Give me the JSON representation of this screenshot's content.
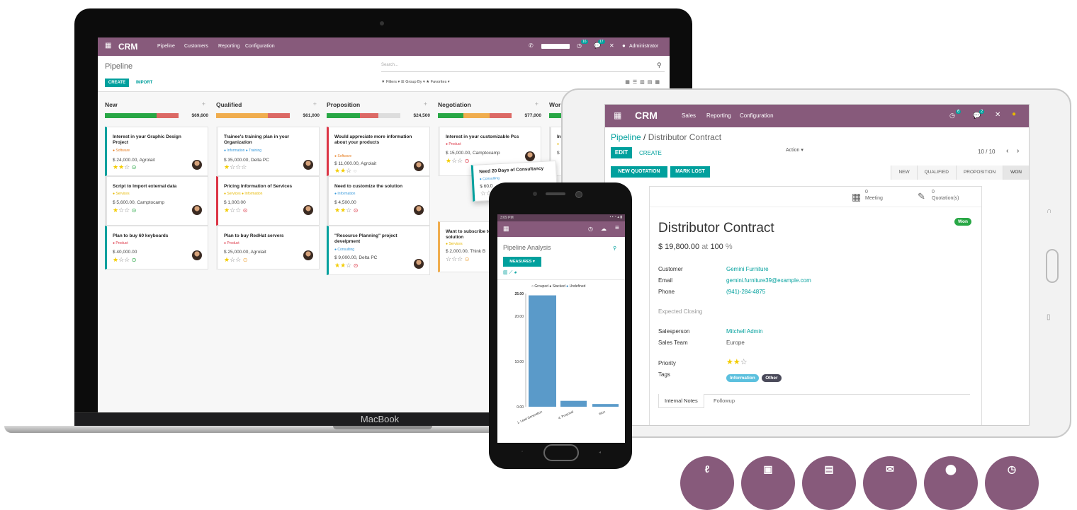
{
  "laptop": {
    "brand": "MacBook",
    "topbar": {
      "app": "CRM",
      "menus": [
        "Pipeline",
        "Customers",
        "Reporting",
        "Configuration"
      ],
      "badges": [
        "16",
        "17"
      ],
      "user": "Administrator"
    },
    "breadcrumb": "Pipeline",
    "create": "CREATE",
    "import": "IMPORT",
    "search_placeholder": "Search...",
    "filters": "▼ Filters ▾   ☰ Group By ▾   ★ Favorites ▾",
    "columns": [
      {
        "title": "New",
        "total": "$69,600",
        "cards": [
          {
            "title": "Interest in your Graphic Design Project",
            "tag": "● Software",
            "amount": "$ 24,000.00, Agrolait",
            "stars": 2
          },
          {
            "title": "Script to Import external data",
            "tag": "● Services",
            "amount": "$ 5,600.00, Camptocamp",
            "stars": 1
          },
          {
            "title": "Plan to buy 60 keyboards",
            "tag": "● Product",
            "amount": "$ 40,000.00",
            "stars": 1
          }
        ]
      },
      {
        "title": "Qualified",
        "total": "$61,000",
        "cards": [
          {
            "title": "Trainee's training plan in your Organization",
            "tag": "● Information ● Training",
            "amount": "$ 35,000.00, Delta PC",
            "stars": 1
          },
          {
            "title": "Pricing Information of Services",
            "tag": "● Services ● Information",
            "amount": "$ 1,000.00",
            "stars": 1
          },
          {
            "title": "Plan to buy RedHat servers",
            "tag": "● Product",
            "amount": "$ 25,000.00, Agrolait",
            "stars": 1
          }
        ]
      },
      {
        "title": "Proposition",
        "total": "$24,500",
        "cards": [
          {
            "title": "Would appreciate more information about your products",
            "tag": "● Software",
            "amount": "$ 11,000.00, Agrolait",
            "stars": 2
          },
          {
            "title": "Need to customize the solution",
            "tag": "● Information",
            "amount": "$ 4,500.00",
            "stars": 2
          },
          {
            "title": "\"Resource Planning\" project develpment",
            "tag": "● Consulting",
            "amount": "$ 9,000.00, Delta PC",
            "stars": 2
          }
        ]
      },
      {
        "title": "Negotiation",
        "total": "$77,000",
        "cards": [
          {
            "title": "Interest in your customizable Pcs",
            "tag": "● Product",
            "amount": "$ 15,000.00, Camptocamp",
            "stars": 1
          },
          {
            "title": "Want to subscribe to your online solution",
            "tag": "● Services",
            "amount": "$ 2,000.00, Think B",
            "stars": 0
          }
        ]
      },
      {
        "title": "Wor",
        "total": "",
        "cards": [
          {
            "title": "In",
            "tag": "●",
            "amount": "$",
            "stars": 0
          }
        ]
      }
    ],
    "dragging_card": {
      "title": "Need 20 Days of Consultancy",
      "tag": "● Consulting",
      "amount": "$ 60,0"
    }
  },
  "tablet": {
    "topbar": {
      "app": "CRM",
      "menus": [
        "Sales",
        "Reporting",
        "Configuration"
      ],
      "badges": [
        "6",
        "2"
      ]
    },
    "breadcrumb_link": "Pipeline",
    "breadcrumb_sep": "/",
    "breadcrumb_current": "Distributor Contract",
    "edit": "EDIT",
    "create": "CREATE",
    "action": "Action ▾",
    "pager": "10 / 10",
    "new_quotation": "NEW QUOTATION",
    "mark_lost": "MARK LOST",
    "stages": [
      "NEW",
      "QUALIFIED",
      "PROPOSITION",
      "WON"
    ],
    "meeting_count": "0",
    "meeting_label": "Meeting",
    "quotation_count": "0",
    "quotation_label": "Quotation(s)",
    "won_badge": "Won",
    "title": "Distributor Contract",
    "revenue": "$ 19,800.00",
    "at": "at",
    "probability": "100",
    "percent": "%",
    "fields": {
      "customer_label": "Customer",
      "customer": "Gemini Furniture",
      "email_label": "Email",
      "email": "gemini.furniture39@example.com",
      "phone_label": "Phone",
      "phone": "(941)-284-4875",
      "expected_closing_label": "Expected Closing",
      "salesperson_label": "Salesperson",
      "salesperson": "Mitchell Admin",
      "team_label": "Sales Team",
      "team": "Europe",
      "priority_label": "Priority",
      "tags_label": "Tags"
    },
    "tags": [
      "Information",
      "Other"
    ],
    "tabs": [
      "Internal Notes",
      "Followup"
    ]
  },
  "phone": {
    "status_time": "3:09 PM",
    "title": "Pipeline Analysis",
    "measures": "MEASURES ▾",
    "legend": [
      "Grouped",
      "Stacked",
      "Undefined"
    ],
    "colors": {
      "bar": "#5a9ac9",
      "accent": "#00a09d",
      "brand": "#875a7b"
    }
  },
  "chart_data": {
    "type": "bar",
    "categories": [
      "1. Lead Generation",
      "4. Proposal",
      "Won"
    ],
    "values": [
      24.6,
      1.3,
      0.6
    ],
    "yticks": [
      "25.00",
      "20.00",
      "10.00",
      "0.00"
    ],
    "ylim": [
      0,
      25
    ]
  },
  "colors": {
    "brand": "#875a7b",
    "accent": "#00a09d",
    "star": "#f3cc00"
  }
}
